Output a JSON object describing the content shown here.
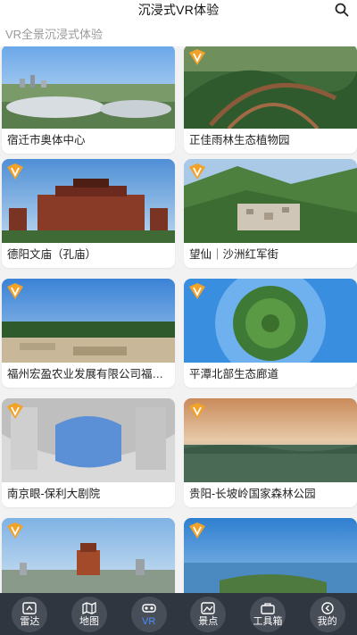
{
  "header": {
    "title": "沉浸式VR体验",
    "subtitle": "VR全景沉浸式体验",
    "search_icon": "search-icon"
  },
  "colors": {
    "bottom_bar": "#2f3640",
    "active_tab": "#4c8dff",
    "badge": "#f2a227"
  },
  "cards": [
    {
      "label": "宿迁市奥体中心",
      "badge": false
    },
    {
      "label": "正佳雨林生态植物园",
      "badge": true
    },
    {
      "label": "德阳文庙（孔庙）",
      "badge": true
    },
    {
      "label": "望仙｜沙洲红军街",
      "badge": true
    },
    {
      "label": "福州宏盈农业发展有限公司福建省…",
      "badge": true
    },
    {
      "label": "平潭北部生态廊道",
      "badge": true
    },
    {
      "label": "南京眼-保利大剧院",
      "badge": true
    },
    {
      "label": "贵阳-长坡岭国家森林公园",
      "badge": true
    },
    {
      "label": "",
      "badge": true
    },
    {
      "label": "",
      "badge": true
    }
  ],
  "tabs": [
    {
      "label": "雷达",
      "icon": "radar-icon"
    },
    {
      "label": "地图",
      "icon": "map-icon"
    },
    {
      "label": "VR",
      "icon": "vr-icon",
      "active": true
    },
    {
      "label": "景点",
      "icon": "scenic-spot-icon"
    },
    {
      "label": "工具箱",
      "icon": "toolbox-icon"
    },
    {
      "label": "我的",
      "icon": "profile-icon"
    }
  ]
}
